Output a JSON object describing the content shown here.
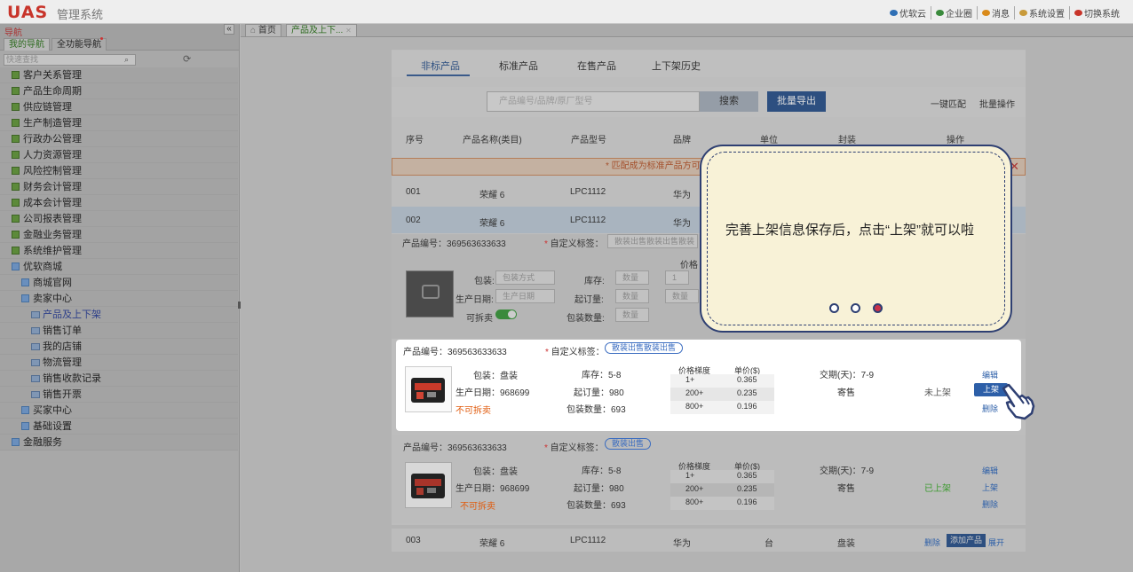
{
  "header": {
    "logo": "UAS",
    "system_name": "管理系统",
    "nav": [
      {
        "label": "优软云",
        "color": "#2f6fb5"
      },
      {
        "label": "企业圈",
        "color": "#3a8a3c"
      },
      {
        "label": "消息",
        "color": "#d98a1a"
      },
      {
        "label": "系统设置",
        "color": "#c89a3a"
      },
      {
        "label": "切换系统",
        "color": "#c8342a"
      }
    ]
  },
  "sidebar": {
    "title": "导航",
    "collapse": "«",
    "tabs": [
      "我的导航",
      "全功能导航"
    ],
    "search_placeholder": "快速查找",
    "menu": [
      {
        "label": "客户关系管理",
        "level": 0,
        "icon": "folder-green"
      },
      {
        "label": "产品生命周期",
        "level": 0,
        "icon": "folder-green"
      },
      {
        "label": "供应链管理",
        "level": 0,
        "icon": "folder-green"
      },
      {
        "label": "生产制造管理",
        "level": 0,
        "icon": "folder-green"
      },
      {
        "label": "行政办公管理",
        "level": 0,
        "icon": "folder-green"
      },
      {
        "label": "人力资源管理",
        "level": 0,
        "icon": "folder-green"
      },
      {
        "label": "风险控制管理",
        "level": 0,
        "icon": "folder-green"
      },
      {
        "label": "财务会计管理",
        "level": 0,
        "icon": "folder-green"
      },
      {
        "label": "成本会计管理",
        "level": 0,
        "icon": "folder-green"
      },
      {
        "label": "公司报表管理",
        "level": 0,
        "icon": "folder-green"
      },
      {
        "label": "金融业务管理",
        "level": 0,
        "icon": "folder-green"
      },
      {
        "label": "系统维护管理",
        "level": 0,
        "icon": "folder-green"
      },
      {
        "label": "优软商城",
        "level": 0,
        "icon": "folder-blue"
      },
      {
        "label": "商城官网",
        "level": 1,
        "icon": "folder-blue"
      },
      {
        "label": "卖家中心",
        "level": 1,
        "icon": "folder-blue"
      },
      {
        "label": "产品及上下架",
        "level": 2,
        "icon": "doc",
        "active": true
      },
      {
        "label": "销售订单",
        "level": 2,
        "icon": "doc"
      },
      {
        "label": "我的店铺",
        "level": 2,
        "icon": "doc"
      },
      {
        "label": "物流管理",
        "level": 2,
        "icon": "doc"
      },
      {
        "label": "销售收款记录",
        "level": 2,
        "icon": "doc"
      },
      {
        "label": "销售开票",
        "level": 2,
        "icon": "doc"
      },
      {
        "label": "买家中心",
        "level": 1,
        "icon": "folder-blue"
      },
      {
        "label": "基础设置",
        "level": 1,
        "icon": "folder-blue"
      },
      {
        "label": "金融服务",
        "level": 0,
        "icon": "folder-blue"
      }
    ]
  },
  "page_tabs": [
    "首页",
    "产品及上下..."
  ],
  "subtabs": [
    "非标产品",
    "标准产品",
    "在售产品",
    "上下架历史"
  ],
  "toolbar": {
    "search_placeholder": "产品编号/品牌/原厂型号",
    "search_label": "搜索",
    "export_label": "批量导出",
    "match_label": "一键匹配",
    "batch_label": "批量操作"
  },
  "table_headers": [
    "序号",
    "产品名称(类目)",
    "产品型号",
    "品牌",
    "单位",
    "封装",
    "操作"
  ],
  "warning": "* 匹配成为标准产品方可",
  "rows": [
    {
      "no": "001",
      "name": "荣耀 6",
      "model": "LPC1112",
      "brand": "华为"
    },
    {
      "no": "002",
      "name": "荣耀 6",
      "model": "LPC1112",
      "brand": "华为"
    }
  ],
  "edit_form": {
    "product_id": "产品编号：369563633633",
    "tag_label": "自定义标签：",
    "tag_placeholder": "散装出售散装出售散装",
    "pack_label": "包装:",
    "pack_placeholder": "包装方式",
    "date_label": "生产日期:",
    "date_placeholder": "生产日期",
    "split_label": "可拆卖",
    "stock_label": "库存:",
    "stock_placeholder": "数量",
    "moq_label": "起订量:",
    "moq_placeholder": "数量",
    "packqty_label": "包装数量:",
    "packqty_placeholder": "数量",
    "price_label": "价格",
    "tier1": "1",
    "tier_qty_placeholder": "数量"
  },
  "highlight_item": {
    "product_id": "产品编号：369563633633",
    "tag_label": "自定义标签：",
    "tag": "散装出售散装出售",
    "pack": "包装：盘装",
    "date": "生产日期：968699",
    "split": "不可拆卖",
    "stock": "库存：5-8",
    "moq": "起订量：980",
    "packqty": "包装数量：693",
    "price_headers": [
      "价格梯度",
      "单价($)"
    ],
    "price_rows": [
      [
        "1+",
        "0.365"
      ],
      [
        "200+",
        "0.235"
      ],
      [
        "800+",
        "0.196"
      ]
    ],
    "lead_time": "交期(天)：7-9",
    "sale_type": "寄售",
    "status": "未上架",
    "edit": "编辑",
    "shelve": "上架",
    "delete": "删除"
  },
  "lower_item": {
    "product_id": "产品编号：369563633633",
    "tag_label": "自定义标签：",
    "tag": "散装出售",
    "pack": "包装：盘装",
    "date": "生产日期：968699",
    "split": "不可拆卖",
    "stock": "库存：5-8",
    "moq": "起订量：980",
    "packqty": "包装数量：693",
    "price_headers": [
      "价格梯度",
      "单价($)"
    ],
    "price_rows": [
      [
        "1+",
        "0.365"
      ],
      [
        "200+",
        "0.235"
      ],
      [
        "800+",
        "0.196"
      ]
    ],
    "lead_time": "交期(天)：7-9",
    "sale_type": "寄售",
    "status": "已上架",
    "edit": "编辑",
    "shelve": "上架",
    "delete": "删除"
  },
  "row003": {
    "no": "003",
    "name": "荣耀 6",
    "model": "LPC1112",
    "brand": "华为",
    "unit": "台",
    "pack": "盘装",
    "delete": "删除",
    "add": "添加产品",
    "expand": "展开"
  },
  "tooltip": {
    "text": "完善上架信息保存后，点击“上架”就可以啦",
    "steps": 3,
    "current_step": 3
  },
  "colors": {
    "brand_red": "#c8342a",
    "primary_blue": "#2d4f80",
    "link_blue": "#2d5fa8",
    "alert_red": "#e05a0c",
    "success_green": "#3c9a2f",
    "tooltip_bg": "#f8f2d7",
    "tooltip_border": "#2e3f72"
  }
}
